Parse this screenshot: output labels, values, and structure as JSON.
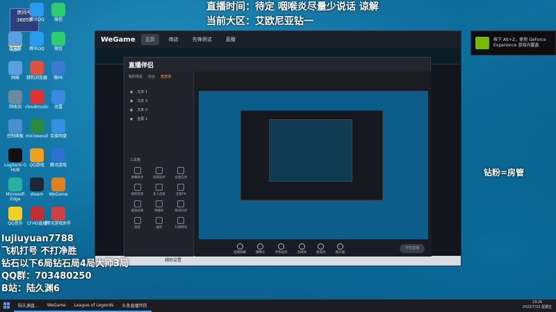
{
  "overlay": {
    "title_line1": "直播时间：待定 咽喉炎尽量少说话 谅解",
    "title_line2": "当前大区：艾欧尼亚钻一",
    "left_lines": [
      "lujiuyuan7788",
      "飞机打号 不打净胜",
      "钻石以下6局钻石局4局大师3局",
      "QQ群：703480250",
      "B站：陆久渊6"
    ],
    "right_text": "钻粉=房管"
  },
  "badge": {
    "line1": "房间号",
    "line2": "36855"
  },
  "desktop_icons": [
    {
      "label": "Adm",
      "color": "#f0c040"
    },
    {
      "label": "腾讯QQ",
      "color": "#2a9cf0"
    },
    {
      "label": "微信",
      "color": "#2ecc71"
    },
    {
      "label": "此电脑",
      "color": "#5aa0e0"
    },
    {
      "label": "腾讯QQ",
      "color": "#2a9cf0"
    },
    {
      "label": "微信",
      "color": "#2ecc71"
    },
    {
      "label": "网络",
      "color": "#5aa0e0"
    },
    {
      "label": "猎豹浏览器",
      "color": "#e05040"
    },
    {
      "label": "微PE",
      "color": "#3a7ad0"
    },
    {
      "label": "回收站",
      "color": "#6a8aa0"
    },
    {
      "label": "cloudmusic",
      "color": "#e03030"
    },
    {
      "label": "迅雷",
      "color": "#3a8ae0"
    },
    {
      "label": "控制面板",
      "color": "#4a90d0"
    },
    {
      "label": "microexcel",
      "color": "#2a8a40"
    },
    {
      "label": "百度网盘",
      "color": "#3a90e0"
    },
    {
      "label": "Logitech G HUB",
      "color": "#101010"
    },
    {
      "label": "QQ游戏",
      "color": "#f0a020"
    },
    {
      "label": "腾讯游戏",
      "color": "#2a70d0"
    },
    {
      "label": "Microsoft Edge",
      "color": "#2ab0a0"
    },
    {
      "label": "steam",
      "color": "#1b2838"
    },
    {
      "label": "WeGame",
      "color": "#e08020"
    },
    {
      "label": "QQ音乐",
      "color": "#f0d020"
    },
    {
      "label": "CFHD直播",
      "color": "#c03030"
    },
    {
      "label": "腾讯游戏助手",
      "color": "#d04040"
    }
  ],
  "wegame": {
    "logo": "WeGame",
    "tabs": [
      "主页",
      "商店",
      "先锋测试",
      "直播"
    ],
    "bottom_text": "辅助设置"
  },
  "companion": {
    "logo": "直播伴侣",
    "left_tabs": [
      "我的场景",
      "前台",
      "竞技场"
    ],
    "layers": [
      "文本 1",
      "文本 3",
      "文本 2",
      "全屏 1"
    ],
    "tools_title": "工具箱",
    "tools": [
      "弹幕助手",
      "房管助手",
      "主播任务",
      "视频连麦",
      "多人连麦",
      "连麦PK",
      "虚拟形象",
      "弹幕机",
      "歌词同步",
      "福袋",
      "抽奖",
      "礼物特效"
    ],
    "controls": [
      "直播屏幕",
      "摄像头",
      "手机投屏",
      "多媒体",
      "麦克风",
      "扬声器"
    ],
    "start_label": "开始直播"
  },
  "nvidia": {
    "line1": "按下 Alt+Z，使用 GeForce",
    "line2": "Experience 游戏内覆盖"
  },
  "taskbar": {
    "items": [
      "陆久渊直...",
      "WeGame",
      "League of Legends",
      "头条直播伴侣"
    ],
    "time": "19:26",
    "date": "2022/7/22 星期五"
  }
}
